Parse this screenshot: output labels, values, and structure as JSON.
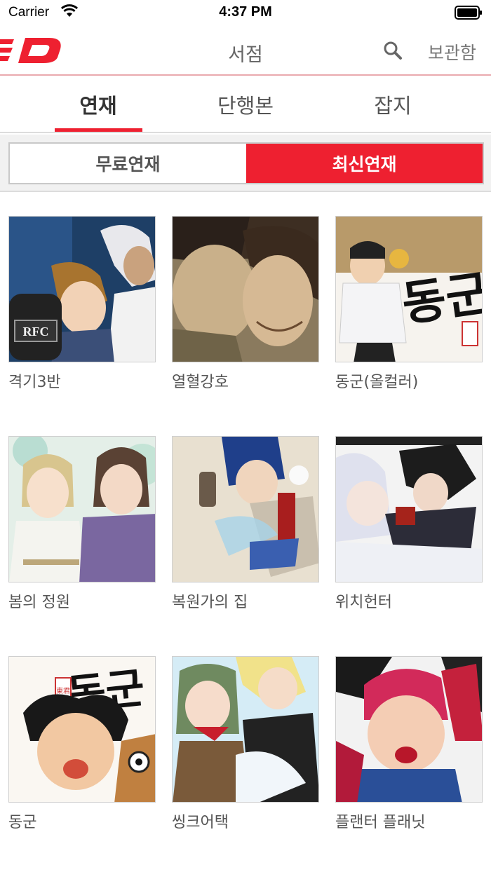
{
  "status_bar": {
    "carrier": "Carrier",
    "time": "4:37 PM"
  },
  "nav": {
    "title": "서점",
    "archive_label": "보관함"
  },
  "tabs": [
    {
      "label": "연재",
      "active": true
    },
    {
      "label": "단행본",
      "active": false
    },
    {
      "label": "잡지",
      "active": false
    }
  ],
  "segment": {
    "free_label": "무료연재",
    "latest_label": "최신연재",
    "selected": "latest"
  },
  "accent_color": "#ee2030",
  "titles": [
    {
      "name": "격기3반"
    },
    {
      "name": "열혈강호"
    },
    {
      "name": "동군(올컬러)"
    },
    {
      "name": "봄의 정원"
    },
    {
      "name": "복원가의 집"
    },
    {
      "name": "위치헌터"
    },
    {
      "name": "동군"
    },
    {
      "name": "씽크어택"
    },
    {
      "name": "플랜터 플래닛"
    }
  ],
  "cover_badges": {
    "rfc": "RFC",
    "donggun_calligraphy": "동군",
    "donggun_seal": "東君"
  }
}
